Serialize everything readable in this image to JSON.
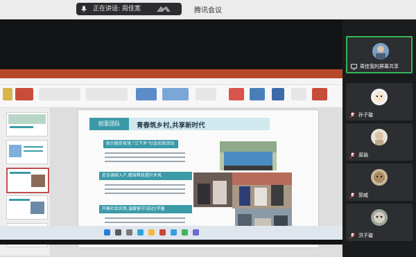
{
  "meeting": {
    "app_title": "腾讯会议",
    "speaking_label": "正在讲话: 周佳宽"
  },
  "slide": {
    "tab_label": "创意团队",
    "heading": "青春筑乡村,共享新时代",
    "bars": [
      "助力脱贫攻坚,“三下乡”社会实践活动",
      "走访调研入户,精准帮扶提升乡风",
      "开展社会实践,温暖留守(送达)学童"
    ]
  },
  "participants": [
    {
      "name": "周佳宽的屏幕共享",
      "active": true
    },
    {
      "name": "孙子璇"
    },
    {
      "name": "周瑜"
    },
    {
      "name": "郭威"
    },
    {
      "name": "洪子璇"
    }
  ],
  "colors": {
    "accent_teal": "#3b9aa8",
    "ppt_red": "#b7472a",
    "active_border": "#32b75a"
  }
}
